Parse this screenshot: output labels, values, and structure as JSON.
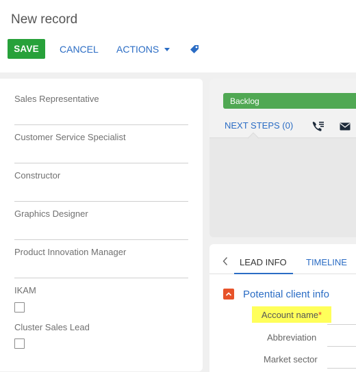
{
  "header": {
    "title": "New record",
    "save_label": "SAVE",
    "cancel_label": "CANCEL",
    "actions_label": "ACTIONS"
  },
  "left_panel": {
    "fields": [
      {
        "label": "Sales Representative"
      },
      {
        "label": "Customer Service Specialist"
      },
      {
        "label": "Constructor"
      },
      {
        "label": "Graphics Designer"
      },
      {
        "label": "Product Innovation Manager"
      }
    ],
    "checkboxes": [
      {
        "label": "IKAM",
        "checked": false
      },
      {
        "label": "Cluster Sales Lead",
        "checked": false
      }
    ]
  },
  "stage_panel": {
    "stage_label": "Backlog",
    "stage_color": "#50a853",
    "next_steps_label": "NEXT STEPS (0)",
    "icons": [
      "call-log-icon",
      "email-icon"
    ]
  },
  "details_panel": {
    "tabs": [
      {
        "label": "LEAD INFO",
        "active": true
      },
      {
        "label": "TIMELINE",
        "active": false
      }
    ],
    "group_title": "Potential client info",
    "account_name_label": "Account name",
    "required_mark": "*",
    "abbreviation_label": "Abbreviation",
    "market_sector_label": "Market sector"
  },
  "colors": {
    "accent": "#2a6cc4",
    "save": "#27a13a",
    "highlight": "#ffff5a",
    "collapse": "#e7532a"
  }
}
